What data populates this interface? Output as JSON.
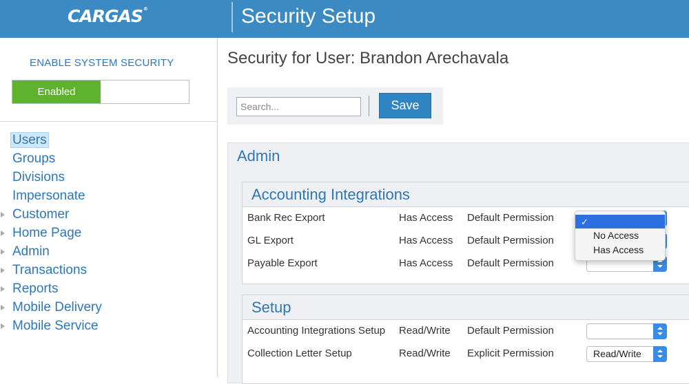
{
  "header": {
    "logo_text": "CARGAS",
    "logo_mark": "®",
    "title": "Security Setup"
  },
  "sidebar": {
    "security_label": "ENABLE SYSTEM SECURITY",
    "toggle_state": "Enabled",
    "nav": [
      {
        "label": "Users",
        "expandable": false,
        "active": true
      },
      {
        "label": "Groups",
        "expandable": false
      },
      {
        "label": "Divisions",
        "expandable": false
      },
      {
        "label": "Impersonate",
        "expandable": false
      },
      {
        "label": "Customer",
        "expandable": true
      },
      {
        "label": "Home Page",
        "expandable": true
      },
      {
        "label": "Admin",
        "expandable": true
      },
      {
        "label": "Transactions",
        "expandable": true
      },
      {
        "label": "Reports",
        "expandable": true
      },
      {
        "label": "Mobile Delivery",
        "expandable": true
      },
      {
        "label": "Mobile Service",
        "expandable": true
      }
    ]
  },
  "main": {
    "page_title": "Security for User: Brandon Arechavala",
    "search_placeholder": "Search...",
    "save_label": "Save",
    "section_title": "Admin",
    "groups": [
      {
        "title": "Accounting Integrations",
        "rows": [
          {
            "name": "Bank Rec Export",
            "access": "Has Access",
            "permission": "Default Permission",
            "select_value": ""
          },
          {
            "name": "GL Export",
            "access": "Has Access",
            "permission": "Default Permission",
            "select_value": ""
          },
          {
            "name": "Payable Export",
            "access": "Has Access",
            "permission": "Default Permission",
            "select_value": ""
          }
        ]
      },
      {
        "title": "Setup",
        "rows": [
          {
            "name": "Accounting Integrations Setup",
            "access": "Read/Write",
            "permission": "Default Permission",
            "select_value": ""
          },
          {
            "name": "Collection Letter Setup",
            "access": "Read/Write",
            "permission": "Explicit Permission",
            "select_value": "Read/Write"
          }
        ]
      }
    ],
    "dropdown": {
      "check_mark": "✓",
      "options": [
        "",
        "No Access",
        "Has Access"
      ]
    }
  },
  "colors": {
    "header_bg": "#3b8ac4",
    "link_blue": "#2d77b7",
    "enabled_green": "#5fb32c",
    "stepper_blue": "#3a8be3",
    "selected_option_bg": "#2d6fe0"
  }
}
